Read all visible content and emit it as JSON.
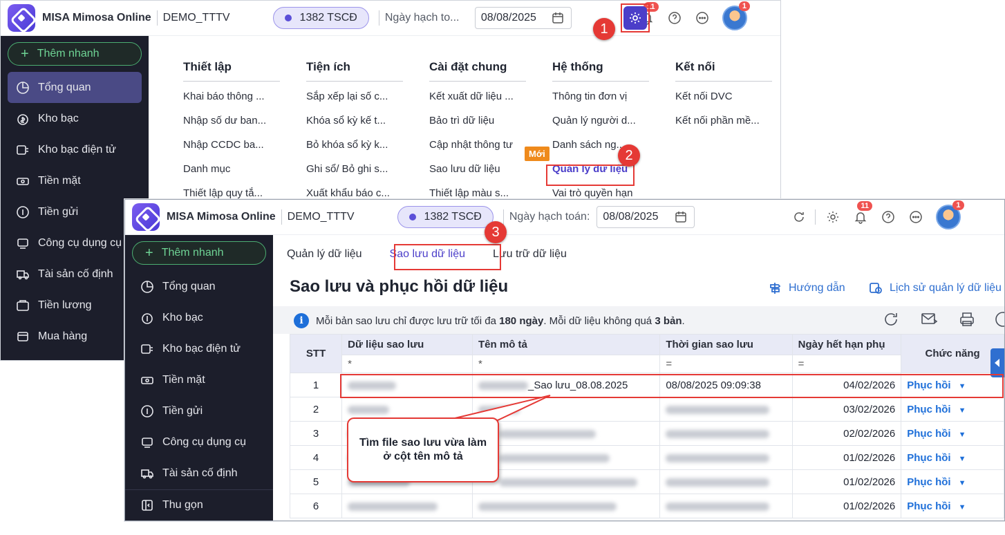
{
  "app": {
    "name": "MISA Mimosa Online",
    "org": "DEMO_TTTV",
    "pill": "1382 TSCĐ",
    "date_label_short": "Ngày hạch to...",
    "date_label": "Ngày hạch toán:",
    "date": "08/08/2025",
    "notif_count": "11",
    "avatar_badge": "1"
  },
  "sidebar": {
    "quick_add": "Thêm nhanh",
    "items_back": [
      "Tổng quan",
      "Kho bạc",
      "Kho bạc điện tử",
      "Tiền mặt",
      "Tiền gửi",
      "Công cụ dụng cụ",
      "Tài sản cố định",
      "Tiền lương",
      "Mua hàng"
    ],
    "items_front": [
      "Tổng quan",
      "Kho bạc",
      "Kho bạc điện tử",
      "Tiền mặt",
      "Tiền gửi",
      "Công cụ dụng cụ",
      "Tài sản cố định"
    ],
    "collapse": "Thu gọn"
  },
  "settings_menu": {
    "columns": [
      {
        "header": "Thiết lập",
        "items": [
          "Khai báo thông ...",
          "Nhập số dư ban...",
          "Nhập CCDC ba...",
          "Danh mục",
          "Thiết lập quy tắ..."
        ]
      },
      {
        "header": "Tiện ích",
        "items": [
          "Sắp xếp lại số c...",
          "Khóa sổ kỳ kế t...",
          "Bỏ khóa sổ kỳ k...",
          "Ghi sổ/ Bỏ ghi s...",
          "Xuất khẩu báo c..."
        ]
      },
      {
        "header": "Cài đặt chung",
        "items": [
          "Kết xuất dữ liệu ...",
          "Bảo trì dữ liệu",
          "Cập nhật thông tư",
          "Sao lưu dữ liệu",
          "Thiết lập màu s..."
        ]
      },
      {
        "header": "Hệ thống",
        "items": [
          "Thông tin đơn vị",
          "Quản lý người d...",
          "Danh sách ng...",
          "Quản lý dữ liệu",
          "Vai trò quyền hạn"
        ]
      },
      {
        "header": "Kết nối",
        "items": [
          "Kết nối DVC",
          "Kết nối phần mề..."
        ]
      }
    ],
    "new_badge": "Mới"
  },
  "steps": [
    "1",
    "2",
    "3"
  ],
  "page": {
    "tabs": [
      "Quản lý dữ liệu",
      "Sao lưu dữ liệu",
      "Lưu trữ dữ liệu"
    ],
    "title": "Sao lưu và phục hồi dữ liệu",
    "guide": "Hướng dẫn",
    "history": "Lịch sử quản lý dữ liệu",
    "note_pre": "Mỗi bản sao lưu chỉ được lưu trữ tối đa",
    "note_days": "180 ngày",
    "note_mid": ". Mỗi dữ liệu không quá",
    "note_count": "3 bản",
    "note_end": "."
  },
  "table": {
    "headers": [
      "STT",
      "Dữ liệu sao lưu",
      "Tên mô tả",
      "Thời gian sao lưu",
      "Ngày hết hạn phụ",
      "Chức năng"
    ],
    "filters": [
      "*",
      "*",
      "=",
      "="
    ],
    "rows": [
      {
        "stt": "1",
        "desc_suffix": "_Sao lưu_08.08.2025",
        "time": "08/08/2025 09:09:38",
        "expiry": "04/02/2026",
        "action": "Phục hồi"
      },
      {
        "stt": "2",
        "desc_suffix": "",
        "time": "",
        "expiry": "03/02/2026",
        "action": "Phục hồi"
      },
      {
        "stt": "3",
        "desc_suffix": "",
        "time": "",
        "expiry": "02/02/2026",
        "action": "Phục hồi"
      },
      {
        "stt": "4",
        "desc_suffix": "",
        "time": "",
        "expiry": "01/02/2026",
        "action": "Phục hồi"
      },
      {
        "stt": "5",
        "desc_suffix": "",
        "time": "",
        "expiry": "01/02/2026",
        "action": "Phục hồi"
      },
      {
        "stt": "6",
        "desc_suffix": "",
        "time": "",
        "expiry": "01/02/2026",
        "action": "Phục hồi"
      }
    ]
  },
  "callout": "Tìm file sao lưu vừa làm ở cột tên mô tả"
}
